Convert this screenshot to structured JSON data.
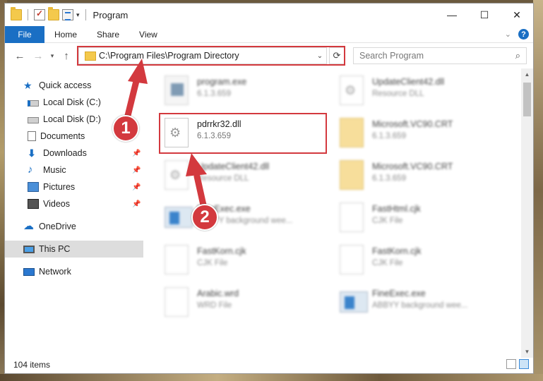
{
  "window": {
    "title": "Program",
    "controls": {
      "minimize": "—",
      "maximize": "☐",
      "close": "✕"
    }
  },
  "ribbon": {
    "tabs": [
      "File",
      "Home",
      "Share",
      "View"
    ],
    "help": "?"
  },
  "address": {
    "path": "C:\\Program Files\\Program Directory",
    "search_placeholder": "Search Program"
  },
  "sidebar": {
    "items": [
      {
        "label": "Quick access",
        "icon": "star-icon"
      },
      {
        "label": "Local Disk (C:)",
        "icon": "drive-icon"
      },
      {
        "label": "Local Disk (D:)",
        "icon": "drive-icon"
      },
      {
        "label": "Documents",
        "icon": "documents-icon"
      },
      {
        "label": "Downloads",
        "icon": "download-icon"
      },
      {
        "label": "Music",
        "icon": "music-icon"
      },
      {
        "label": "Pictures",
        "icon": "pictures-icon"
      },
      {
        "label": "Videos",
        "icon": "videos-icon"
      },
      {
        "label": "OneDrive",
        "icon": "cloud-icon"
      },
      {
        "label": "This PC",
        "icon": "computer-icon",
        "selected": true
      },
      {
        "label": "Network",
        "icon": "network-icon"
      }
    ]
  },
  "files": [
    {
      "name": "program.exe",
      "meta": "6.1.3.659",
      "icon": "exe"
    },
    {
      "name": "UpdateClient42.dll",
      "meta": "Resource DLL",
      "icon": "gear"
    },
    {
      "name": "pdrrkr32.dll",
      "meta": "6.1.3.659",
      "icon": "gear"
    },
    {
      "name": "Microsoft.VC90.CRT",
      "meta": "6.1.3.659",
      "icon": "folder"
    },
    {
      "name": "UpdateClient42.dll",
      "meta": "Resource DLL",
      "icon": "gear"
    },
    {
      "name": "Microsoft.VC90.CRT",
      "meta": "6.1.3.659",
      "icon": "folder"
    },
    {
      "name": "FineExec.exe",
      "meta": "ABBYY background wee...",
      "icon": "app"
    },
    {
      "name": "FastHtml.cjk",
      "meta": "CJK File",
      "icon": "doc"
    },
    {
      "name": "FastKorn.cjk",
      "meta": "CJK File",
      "icon": "doc"
    },
    {
      "name": "FastKorn.cjk",
      "meta": "CJK File",
      "icon": "doc"
    },
    {
      "name": "Arabic.wrd",
      "meta": "WRD File",
      "icon": "doc"
    },
    {
      "name": "FineExec.exe",
      "meta": "ABBYY background wee...",
      "icon": "app"
    }
  ],
  "status": {
    "count": "104 items"
  },
  "annotations": {
    "step1": "1",
    "step2": "2",
    "color": "#d3393e"
  }
}
